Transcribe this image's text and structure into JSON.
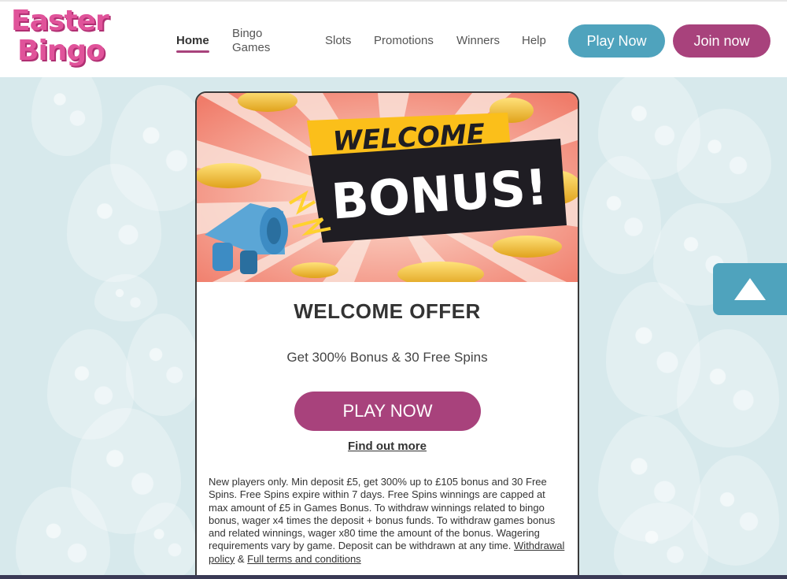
{
  "brand": {
    "logo_line1": "Easter",
    "logo_line2": "Bingo"
  },
  "nav": {
    "home": "Home",
    "bingo_line1": "Bingo",
    "bingo_line2": "Games",
    "slots": "Slots",
    "promotions": "Promotions",
    "winners": "Winners",
    "help": "Help"
  },
  "header_buttons": {
    "play": "Play Now",
    "join": "Join now"
  },
  "banner": {
    "line1": "WELCOME",
    "line2": "BONUS!"
  },
  "offer": {
    "title": "WELCOME OFFER",
    "subtitle": "Get 300% Bonus & 30 Free Spins",
    "cta": "PLAY NOW",
    "find_more": "Find out more",
    "terms_text": "New players only. Min deposit £5, get 300% up to £105 bonus and 30 Free Spins. Free Spins expire within 7 days. Free Spins winnings are capped at max amount of £5 in Games Bonus. To withdraw winnings related to bingo bonus, wager x4 times the deposit + bonus funds. To withdraw games bonus and related winnings, wager x80 time the amount of the bonus. Wagering requirements vary by game. Deposit can be withdrawn at any time.",
    "withdrawal_link": "Withdrawal policy",
    "amp": "&",
    "terms_link": "Full terms and conditions"
  },
  "colors": {
    "primary_purple": "#a8427c",
    "primary_blue": "#4fa3bd",
    "logo_pink": "#e0539a",
    "background": "#d7e9ec"
  },
  "icons": {
    "scroll_top": "arrow-up-icon",
    "megaphone": "megaphone-icon"
  }
}
